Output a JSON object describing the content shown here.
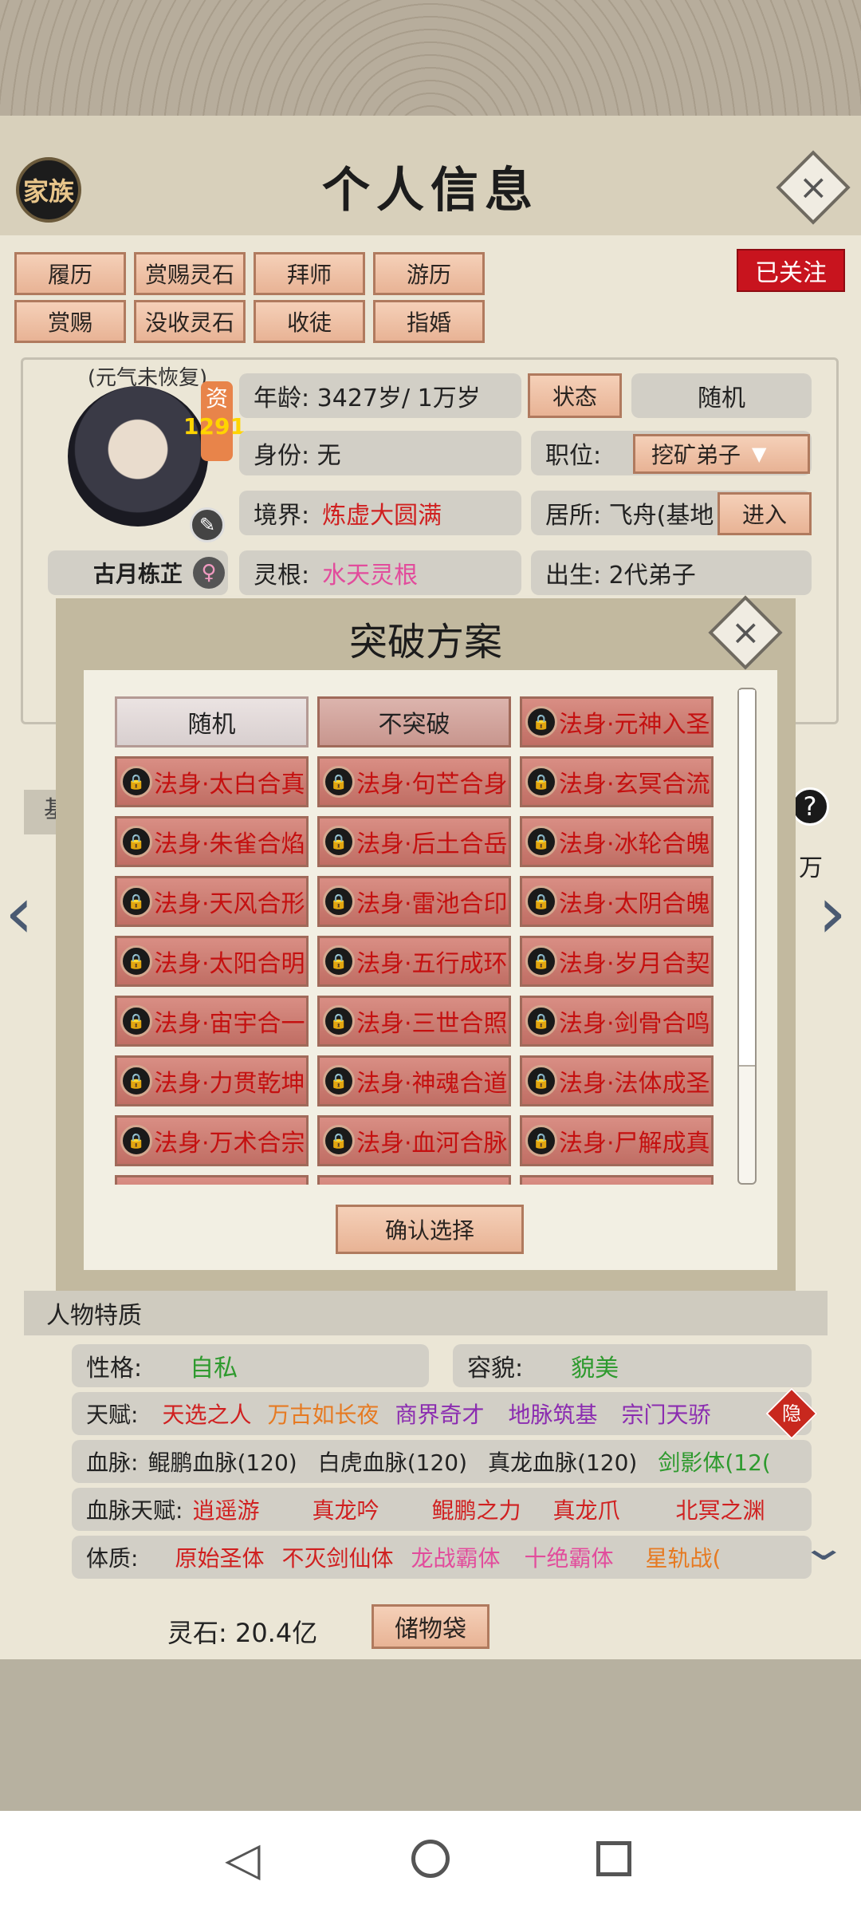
{
  "title": "个人信息",
  "family_badge": "家族",
  "followed_label": "已关注",
  "action_buttons": [
    [
      "履历",
      "赏赐灵石",
      "拜师",
      "游历"
    ],
    [
      "赏赐",
      "没收灵石",
      "收徒",
      "指婚"
    ]
  ],
  "avatar": {
    "status_note": "(元气未恢复)",
    "zi_label": "资",
    "aptitude": "1291",
    "name": "古月栋芷",
    "gender_icon": "female-icon"
  },
  "info": {
    "age": "年龄: 3427岁/ 1万岁",
    "status_btn": "状态",
    "random_btn": "随机",
    "identity": "身份:  无",
    "position_label": "职位:",
    "position_value": "挖矿弟子",
    "realm_label": "境界:",
    "realm_value": "炼虚大圆满",
    "residence": "居所: 飞舟(基地",
    "enter_btn": "进入",
    "root_label": "灵根:",
    "root_value": "水天灵根",
    "birth": "出生:   2代弟子"
  },
  "side_peek": {
    "left_char": "基",
    "right_char": "万",
    "help": "?"
  },
  "dialog": {
    "title": "突破方案",
    "confirm": "确认选择",
    "options": [
      {
        "label": "随机",
        "locked": false
      },
      {
        "label": "不突破",
        "locked": false
      },
      {
        "label": "法身·元神入圣",
        "locked": true
      },
      {
        "label": "法身·太白合真",
        "locked": true
      },
      {
        "label": "法身·句芒合身",
        "locked": true
      },
      {
        "label": "法身·玄冥合流",
        "locked": true
      },
      {
        "label": "法身·朱雀合焰",
        "locked": true
      },
      {
        "label": "法身·后土合岳",
        "locked": true
      },
      {
        "label": "法身·冰轮合魄",
        "locked": true
      },
      {
        "label": "法身·天风合形",
        "locked": true
      },
      {
        "label": "法身·雷池合印",
        "locked": true
      },
      {
        "label": "法身·太阴合魄",
        "locked": true
      },
      {
        "label": "法身·太阳合明",
        "locked": true
      },
      {
        "label": "法身·五行成环",
        "locked": true
      },
      {
        "label": "法身·岁月合契",
        "locked": true
      },
      {
        "label": "法身·宙宇合一",
        "locked": true
      },
      {
        "label": "法身·三世合照",
        "locked": true
      },
      {
        "label": "法身·剑骨合鸣",
        "locked": true
      },
      {
        "label": "法身·力贯乾坤",
        "locked": true
      },
      {
        "label": "法身·神魂合道",
        "locked": true
      },
      {
        "label": "法身·法体成圣",
        "locked": true
      },
      {
        "label": "法身·万术合宗",
        "locked": true
      },
      {
        "label": "法身·血河合脉",
        "locked": true
      },
      {
        "label": "法身·尸解成真",
        "locked": true
      }
    ]
  },
  "traits": {
    "section_title": "人物特质",
    "personality_label": "性格:",
    "personality_value": "自私",
    "looks_label": "容貌:",
    "looks_value": "貌美",
    "talent_label": "天赋:",
    "talents": [
      "天选之人",
      "万古如长夜",
      "商界奇才",
      "地脉筑基",
      "宗门天骄"
    ],
    "hide_label": "隐",
    "bloodline_label": "血脉:",
    "bloodlines": [
      "鲲鹏血脉(120)",
      "白虎血脉(120)",
      "真龙血脉(120)",
      "剑影体(12("
    ],
    "bl_talent_label": "血脉天赋:",
    "bl_talents": [
      "逍遥游",
      "真龙吟",
      "鲲鹏之力",
      "真龙爪",
      "北冥之渊"
    ],
    "physique_label": "体质:",
    "physiques": [
      "原始圣体",
      "不灭剑仙体",
      "龙战霸体",
      "十绝霸体",
      "星轨战("
    ]
  },
  "footer": {
    "spirit_stone": "灵石: 20.4亿",
    "bag_btn": "储物袋"
  }
}
